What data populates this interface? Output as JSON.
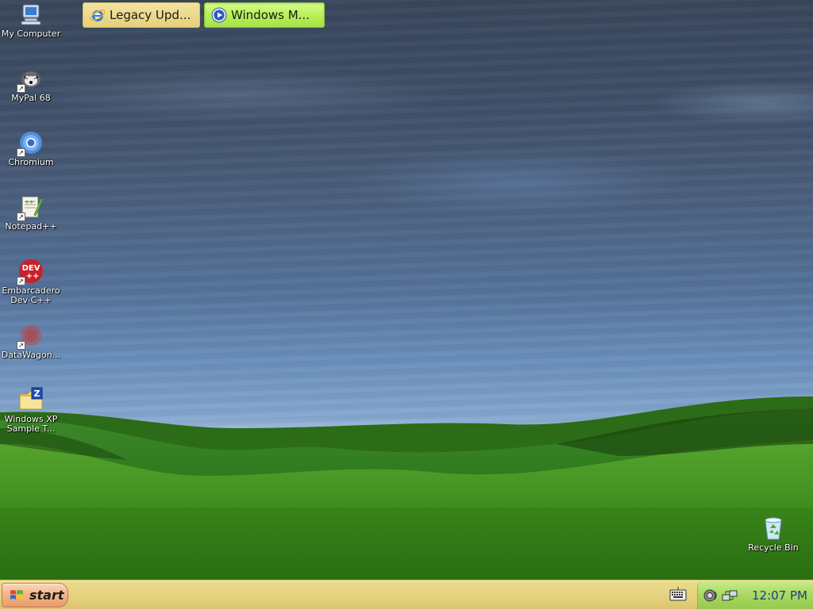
{
  "desktop": {
    "icons": [
      {
        "label": "My Computer",
        "icon": "my-computer-icon",
        "shortcut": false
      },
      {
        "label": "MyPal 68",
        "icon": "mypal-icon",
        "shortcut": true
      },
      {
        "label": "Chromium",
        "icon": "chromium-icon",
        "shortcut": true
      },
      {
        "label": "Notepad++",
        "icon": "notepad-plus-plus-icon",
        "shortcut": true
      },
      {
        "label": "Embarcadero Dev-C++",
        "icon": "dev-cpp-icon",
        "shortcut": true,
        "badge": "DEV ++"
      },
      {
        "label": "DataWagon...",
        "icon": "datawagon-icon",
        "shortcut": true
      },
      {
        "label": "Windows XP Sample T...",
        "icon": "zip-folder-icon",
        "shortcut": false,
        "badge": "Z"
      },
      {
        "label": "Recycle Bin",
        "icon": "recycle-bin-icon",
        "shortcut": false
      }
    ]
  },
  "taskbar": {
    "start_label": "start",
    "tasks": [
      {
        "label": "Legacy Upd...",
        "icon": "internet-explorer-icon",
        "active": false
      },
      {
        "label": "Windows M...",
        "icon": "windows-media-player-icon",
        "active": true
      }
    ],
    "tray": {
      "icons": [
        "volume-icon",
        "network-icon"
      ],
      "clock": "12:07 PM"
    }
  },
  "colors": {
    "taskbar": "#e6d382",
    "active_task": "#b8f05a",
    "tray": "#a8d860",
    "clock_text": "#1f3d7a",
    "start_button": "#f2b68c"
  }
}
